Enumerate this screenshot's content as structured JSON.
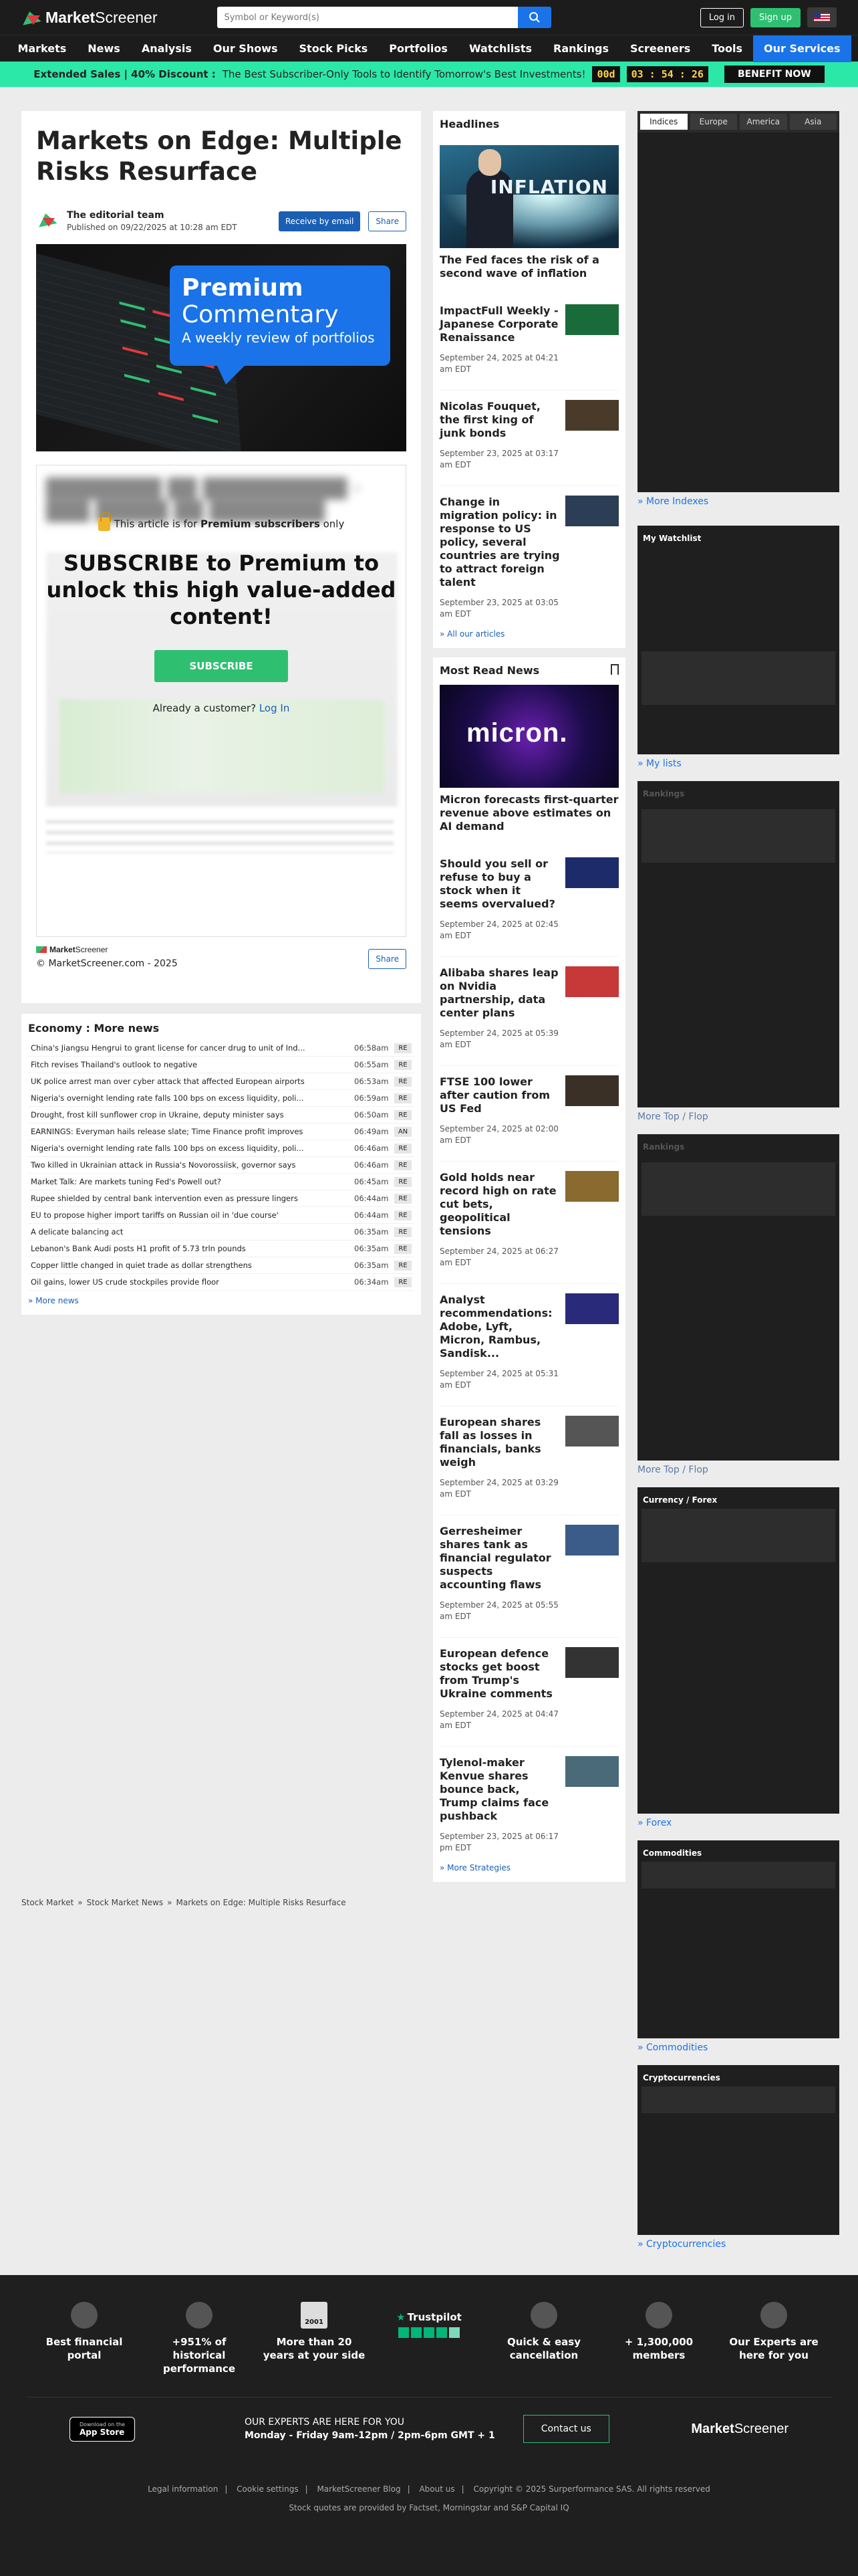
{
  "brand": {
    "name_bold": "Market",
    "name_rest": "Screener"
  },
  "search": {
    "placeholder": "Symbol or Keyword(s)"
  },
  "auth": {
    "login": "Log in",
    "signup": "Sign up"
  },
  "nav": [
    "Markets",
    "News",
    "Analysis",
    "Our Shows",
    "Stock Picks",
    "Portfolios",
    "Watchlists",
    "Rankings",
    "Screeners",
    "Tools",
    "Our Services"
  ],
  "promo": {
    "label": "Extended Sales | 40% Discount :",
    "text": "The Best Subscriber-Only Tools to Identify Tomorrow's Best Investments!",
    "days": "00d",
    "time": "03 : 54 : 26",
    "cta": "BENEFIT NOW"
  },
  "article": {
    "title": "Markets on Edge: Multiple Risks Resurface",
    "author": "The editorial team",
    "published": "Published on 09/22/2025 at 10:28 am EDT",
    "receive_btn": "Receive by email",
    "share_btn": "Share",
    "hero": {
      "line1": "Premium",
      "line2": "Commentary",
      "line3": "A weekly review of portfolios"
    },
    "paywall": {
      "note_pre": "This article is for ",
      "note_bold": "Premium subscribers",
      "note_post": " only",
      "headline": "SUBSCRIBE to Premium to unlock this high value-added content!",
      "button": "SUBSCRIBE",
      "already": "Already a customer?",
      "login": "Log In"
    },
    "copyright": "© MarketScreener.com - 2025"
  },
  "economy": {
    "title": "Economy : More news",
    "rows": [
      {
        "title": "China's Jiangsu Hengrui to grant license for cancer drug to unit of Ind...",
        "time": "06:58am",
        "tag": "RE"
      },
      {
        "title": "Fitch revises Thailand's outlook to negative",
        "time": "06:55am",
        "tag": "RE"
      },
      {
        "title": "UK police arrest man over cyber attack that affected European airports",
        "time": "06:53am",
        "tag": "RE"
      },
      {
        "title": "Nigeria's overnight lending rate falls 100 bps on excess liquidity, poli...",
        "time": "06:59am",
        "tag": "RE"
      },
      {
        "title": "Drought, frost kill sunflower crop in Ukraine, deputy minister says",
        "time": "06:50am",
        "tag": "RE"
      },
      {
        "title": "EARNINGS: Everyman hails release slate; Time Finance profit improves",
        "time": "06:49am",
        "tag": "AN"
      },
      {
        "title": "Nigeria's overnight lending rate falls 100 bps on excess liquidity, poli...",
        "time": "06:46am",
        "tag": "RE"
      },
      {
        "title": "Two killed in Ukrainian attack in Russia's Novorossiisk, governor says",
        "time": "06:46am",
        "tag": "RE"
      },
      {
        "title": "Market Talk: Are markets tuning Fed's Powell out?",
        "time": "06:45am",
        "tag": "RE"
      },
      {
        "title": "Rupee shielded by central bank intervention even as pressure lingers",
        "time": "06:44am",
        "tag": "RE"
      },
      {
        "title": "EU to propose higher import tariffs on Russian oil in 'due course'",
        "time": "06:44am",
        "tag": "RE"
      },
      {
        "title": "A delicate balancing act",
        "time": "06:35am",
        "tag": "RE"
      },
      {
        "title": "Lebanon's Bank Audi posts H1 profit of 5.73 trln pounds",
        "time": "06:35am",
        "tag": "RE"
      },
      {
        "title": "Copper little changed in quiet trade as dollar strengthens",
        "time": "06:35am",
        "tag": "RE"
      },
      {
        "title": "Oil gains, lower US crude stockpiles provide floor",
        "time": "06:34am",
        "tag": "RE"
      }
    ],
    "more": "» More news"
  },
  "headlines": {
    "title": "Headlines",
    "feature_word": "INFLATION",
    "feature_title": "The Fed faces the risk of a second wave of inflation",
    "items": [
      {
        "title": "ImpactFull Weekly - Japanese Corporate Renaissance",
        "date": "September 24, 2025 at 04:21 am EDT",
        "color": "#1a6b3a"
      },
      {
        "title": "Nicolas Fouquet, the first king of junk bonds",
        "date": "September 23, 2025 at 03:17 am EDT",
        "color": "#4a3a2a"
      },
      {
        "title": "Change in migration policy: in response to US policy, several countries are trying to attract foreign talent",
        "date": "September 23, 2025 at 03:05 am EDT",
        "color": "#2c3e55"
      }
    ],
    "more": "» All our articles"
  },
  "mostread": {
    "title": "Most Read News",
    "feature_word": "micron.",
    "feature_title": "Micron forecasts first-quarter revenue above estimates on AI demand",
    "items": [
      {
        "title": "Should you sell or refuse to buy a stock when it seems overvalued?",
        "date": "September 24, 2025 at 02:45 am EDT",
        "color": "#1d2b6b"
      },
      {
        "title": "Alibaba shares leap on Nvidia partnership, data center plans",
        "date": "September 24, 2025 at 05:39 am EDT",
        "color": "#c73838"
      },
      {
        "title": "FTSE 100 lower after caution from US Fed",
        "date": "September 24, 2025 at 02:00 am EDT",
        "color": "#3b3025"
      },
      {
        "title": "Gold holds near record high on rate cut bets, geopolitical tensions",
        "date": "September 24, 2025 at 06:27 am EDT",
        "color": "#8a6a2f"
      },
      {
        "title": "Analyst recommendations: Adobe, Lyft, Micron, Rambus, Sandisk...",
        "date": "September 24, 2025 at 05:31 am EDT",
        "color": "#2a2a7a"
      },
      {
        "title": "European shares fall as losses in financials, banks weigh",
        "date": "September 24, 2025 at 03:29 am EDT",
        "color": "#555555"
      },
      {
        "title": "Gerresheimer shares tank as financial regulator suspects accounting flaws",
        "date": "September 24, 2025 at 05:55 am EDT",
        "color": "#3b5b88"
      },
      {
        "title": "European defence stocks get boost from Trump's Ukraine comments",
        "date": "September 24, 2025 at 04:47 am EDT",
        "color": "#333333"
      },
      {
        "title": "Tylenol-maker Kenvue shares bounce back, Trump claims face pushback",
        "date": "September 23, 2025 at 06:17 pm EDT",
        "color": "#4a6a7a"
      }
    ],
    "more": "» More Strategies"
  },
  "right": {
    "tabs": [
      "Indices",
      "Europe",
      "America",
      "Asia"
    ],
    "indexes_more": "» More Indexes",
    "watchlist_title": "My Watchlist",
    "watchlist_more": "» My lists",
    "rankings1_title": "Rankings",
    "rankings1_more": "More Top / Flop",
    "rankings2_title": "Rankings",
    "rankings2_more": "More Top / Flop",
    "forex_title": "Currency / Forex",
    "forex_more": "» Forex",
    "commodities_title": "Commodities",
    "commodities_more": "» Commodities",
    "crypto_title": "Cryptocurrencies",
    "crypto_more": "» Cryptocurrencies"
  },
  "breadcrumb": [
    "Stock Market",
    "Stock Market News",
    "Markets on Edge: Multiple Risks Resurface"
  ],
  "footer": {
    "features": [
      {
        "label": "Best financial portal"
      },
      {
        "label": "+951% of historical performance"
      },
      {
        "label": "More than 20 years at your side",
        "badge": "2001"
      },
      {
        "label": "Trustpilot"
      },
      {
        "label": "Quick & easy cancellation"
      },
      {
        "label": "+ 1,300,000 members"
      },
      {
        "label": "Our Experts are here for you"
      }
    ],
    "appstore_small": "Download on the",
    "appstore": "App Store",
    "hours_title": "OUR EXPERTS ARE HERE FOR YOU",
    "hours": "Monday - Friday 9am-12pm / 2pm-6pm GMT + 1",
    "contact": "Contact us",
    "links": [
      "Legal information",
      "Cookie settings",
      "MarketScreener Blog",
      "About us",
      "Copyright © 2025 Surperformance SAS. All rights reserved"
    ],
    "sources": "Stock quotes are provided by Factset, Morningstar and S&P Capital IQ"
  }
}
